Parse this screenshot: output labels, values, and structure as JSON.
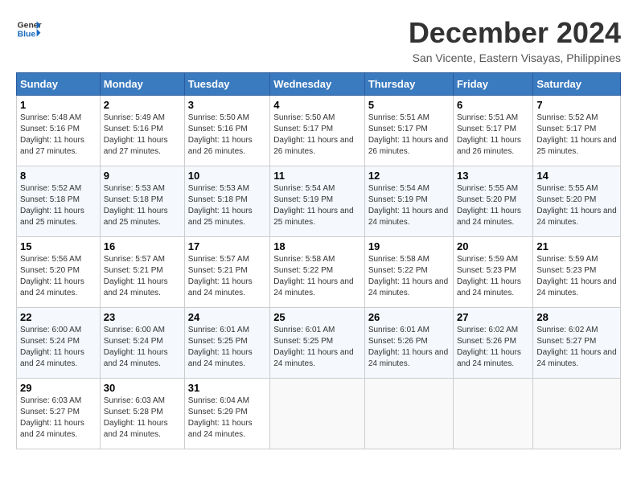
{
  "logo": {
    "line1": "General",
    "line2": "Blue"
  },
  "title": "December 2024",
  "location": "San Vicente, Eastern Visayas, Philippines",
  "days_of_week": [
    "Sunday",
    "Monday",
    "Tuesday",
    "Wednesday",
    "Thursday",
    "Friday",
    "Saturday"
  ],
  "weeks": [
    [
      {
        "day": "1",
        "sunrise": "5:48 AM",
        "sunset": "5:16 PM",
        "daylight": "11 hours and 27 minutes."
      },
      {
        "day": "2",
        "sunrise": "5:49 AM",
        "sunset": "5:16 PM",
        "daylight": "11 hours and 27 minutes."
      },
      {
        "day": "3",
        "sunrise": "5:50 AM",
        "sunset": "5:16 PM",
        "daylight": "11 hours and 26 minutes."
      },
      {
        "day": "4",
        "sunrise": "5:50 AM",
        "sunset": "5:17 PM",
        "daylight": "11 hours and 26 minutes."
      },
      {
        "day": "5",
        "sunrise": "5:51 AM",
        "sunset": "5:17 PM",
        "daylight": "11 hours and 26 minutes."
      },
      {
        "day": "6",
        "sunrise": "5:51 AM",
        "sunset": "5:17 PM",
        "daylight": "11 hours and 26 minutes."
      },
      {
        "day": "7",
        "sunrise": "5:52 AM",
        "sunset": "5:17 PM",
        "daylight": "11 hours and 25 minutes."
      }
    ],
    [
      {
        "day": "8",
        "sunrise": "5:52 AM",
        "sunset": "5:18 PM",
        "daylight": "11 hours and 25 minutes."
      },
      {
        "day": "9",
        "sunrise": "5:53 AM",
        "sunset": "5:18 PM",
        "daylight": "11 hours and 25 minutes."
      },
      {
        "day": "10",
        "sunrise": "5:53 AM",
        "sunset": "5:18 PM",
        "daylight": "11 hours and 25 minutes."
      },
      {
        "day": "11",
        "sunrise": "5:54 AM",
        "sunset": "5:19 PM",
        "daylight": "11 hours and 25 minutes."
      },
      {
        "day": "12",
        "sunrise": "5:54 AM",
        "sunset": "5:19 PM",
        "daylight": "11 hours and 24 minutes."
      },
      {
        "day": "13",
        "sunrise": "5:55 AM",
        "sunset": "5:20 PM",
        "daylight": "11 hours and 24 minutes."
      },
      {
        "day": "14",
        "sunrise": "5:55 AM",
        "sunset": "5:20 PM",
        "daylight": "11 hours and 24 minutes."
      }
    ],
    [
      {
        "day": "15",
        "sunrise": "5:56 AM",
        "sunset": "5:20 PM",
        "daylight": "11 hours and 24 minutes."
      },
      {
        "day": "16",
        "sunrise": "5:57 AM",
        "sunset": "5:21 PM",
        "daylight": "11 hours and 24 minutes."
      },
      {
        "day": "17",
        "sunrise": "5:57 AM",
        "sunset": "5:21 PM",
        "daylight": "11 hours and 24 minutes."
      },
      {
        "day": "18",
        "sunrise": "5:58 AM",
        "sunset": "5:22 PM",
        "daylight": "11 hours and 24 minutes."
      },
      {
        "day": "19",
        "sunrise": "5:58 AM",
        "sunset": "5:22 PM",
        "daylight": "11 hours and 24 minutes."
      },
      {
        "day": "20",
        "sunrise": "5:59 AM",
        "sunset": "5:23 PM",
        "daylight": "11 hours and 24 minutes."
      },
      {
        "day": "21",
        "sunrise": "5:59 AM",
        "sunset": "5:23 PM",
        "daylight": "11 hours and 24 minutes."
      }
    ],
    [
      {
        "day": "22",
        "sunrise": "6:00 AM",
        "sunset": "5:24 PM",
        "daylight": "11 hours and 24 minutes."
      },
      {
        "day": "23",
        "sunrise": "6:00 AM",
        "sunset": "5:24 PM",
        "daylight": "11 hours and 24 minutes."
      },
      {
        "day": "24",
        "sunrise": "6:01 AM",
        "sunset": "5:25 PM",
        "daylight": "11 hours and 24 minutes."
      },
      {
        "day": "25",
        "sunrise": "6:01 AM",
        "sunset": "5:25 PM",
        "daylight": "11 hours and 24 minutes."
      },
      {
        "day": "26",
        "sunrise": "6:01 AM",
        "sunset": "5:26 PM",
        "daylight": "11 hours and 24 minutes."
      },
      {
        "day": "27",
        "sunrise": "6:02 AM",
        "sunset": "5:26 PM",
        "daylight": "11 hours and 24 minutes."
      },
      {
        "day": "28",
        "sunrise": "6:02 AM",
        "sunset": "5:27 PM",
        "daylight": "11 hours and 24 minutes."
      }
    ],
    [
      {
        "day": "29",
        "sunrise": "6:03 AM",
        "sunset": "5:27 PM",
        "daylight": "11 hours and 24 minutes."
      },
      {
        "day": "30",
        "sunrise": "6:03 AM",
        "sunset": "5:28 PM",
        "daylight": "11 hours and 24 minutes."
      },
      {
        "day": "31",
        "sunrise": "6:04 AM",
        "sunset": "5:29 PM",
        "daylight": "11 hours and 24 minutes."
      },
      null,
      null,
      null,
      null
    ]
  ],
  "labels": {
    "sunrise_prefix": "Sunrise: ",
    "sunset_prefix": "Sunset: ",
    "daylight_prefix": "Daylight: "
  }
}
